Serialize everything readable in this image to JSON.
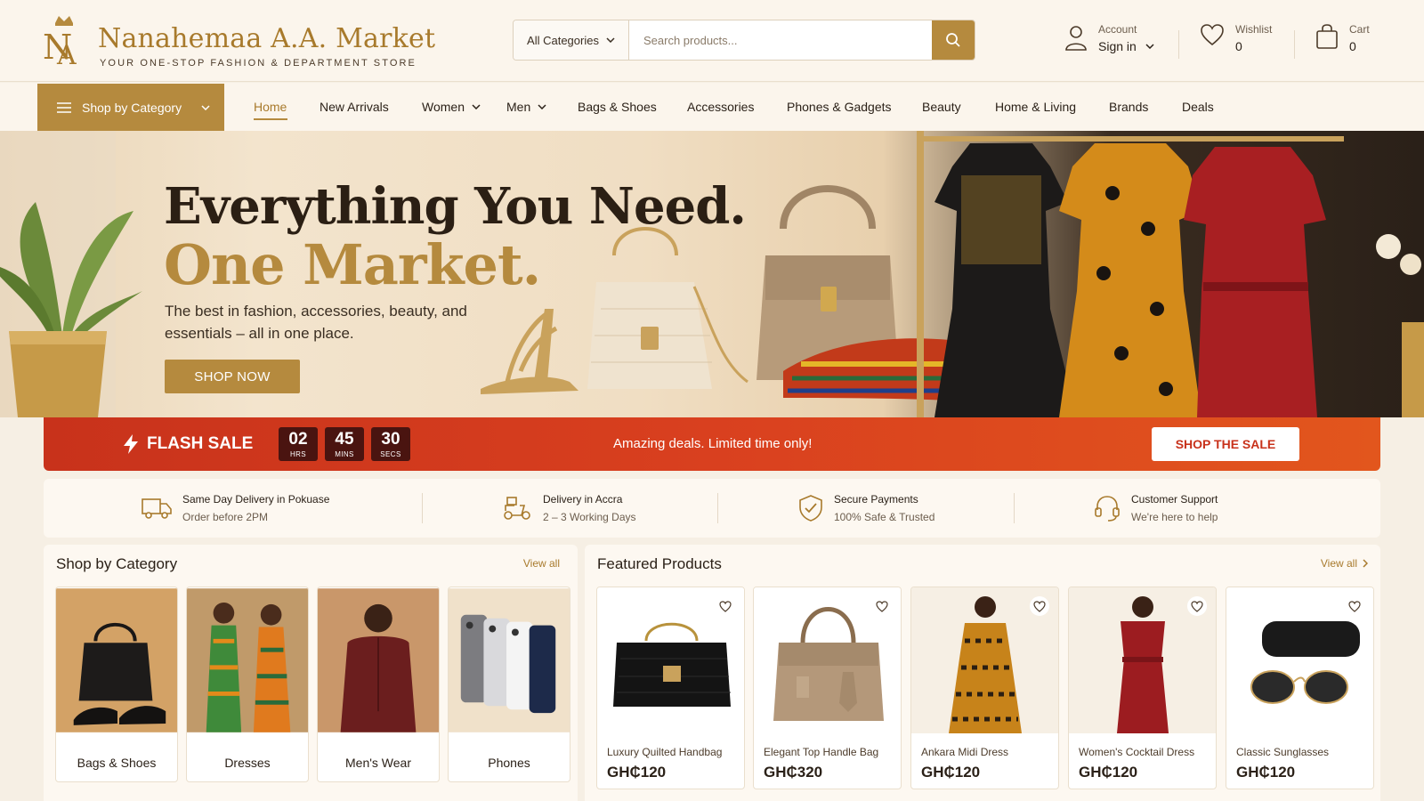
{
  "brand": {
    "name": "Nanahemaa A.A. Market",
    "tagline": "YOUR ONE-STOP FASHION & DEPARTMENT STORE",
    "accent_color": "#b58a3e"
  },
  "search": {
    "category": "All Categories",
    "placeholder": "Search products...",
    "icon": "search-icon"
  },
  "account": {
    "label": "Account",
    "action": "Sign in"
  },
  "wishlist": {
    "label": "Wishlist",
    "count": "0"
  },
  "cart": {
    "label": "Cart",
    "count": "0"
  },
  "nav": {
    "category_button": "Shop by Category",
    "links": [
      "Home",
      "New Arrivals",
      "Women",
      "Men",
      "Bags & Shoes",
      "Accessories",
      "Phones & Gadgets",
      "Beauty",
      "Home & Living",
      "Brands",
      "Deals"
    ],
    "active": "Home"
  },
  "hero": {
    "title_line1": "Everything You Need.",
    "title_line2": "One Market.",
    "subtitle": "The best in fashion, accessories, beauty, and essentials – all in one place.",
    "cta": "SHOP NOW"
  },
  "flash_sale": {
    "label": "FLASH SALE",
    "hours": "02",
    "hours_unit": "HRS",
    "mins": "45",
    "mins_unit": "MINS",
    "secs": "30",
    "secs_unit": "SECS",
    "message": "Amazing deals. Limited time only!",
    "cta": "SHOP THE SALE",
    "color": "#d9401f"
  },
  "features": [
    {
      "title": "Same Day Delivery in Pokuase",
      "subtitle": "Order before 2PM",
      "icon": "truck-icon"
    },
    {
      "title": "Delivery in Accra",
      "subtitle": "2 – 3 Working Days",
      "icon": "scooter-icon"
    },
    {
      "title": "Secure Payments",
      "subtitle": "100% Safe & Trusted",
      "icon": "shield-check-icon"
    },
    {
      "title": "Customer Support",
      "subtitle": "We're here to help",
      "icon": "headset-icon"
    }
  ],
  "categories_panel": {
    "title": "Shop by Category",
    "view_all": "View all",
    "items": [
      "Bags & Shoes",
      "Dresses",
      "Men's Wear",
      "Phones"
    ]
  },
  "featured_panel": {
    "title": "Featured Products",
    "view_all": "View all",
    "products": [
      {
        "name": "Luxury Quilted Handbag",
        "price": "GH₵120"
      },
      {
        "name": "Elegant Top Handle Bag",
        "price": "GH₵320"
      },
      {
        "name": "Ankara Midi Dress",
        "price": "GH₵120"
      },
      {
        "name": "Women's Cocktail Dress",
        "price": "GH₵120"
      },
      {
        "name": "Classic Sunglasses",
        "price": "GH₵120"
      }
    ]
  }
}
